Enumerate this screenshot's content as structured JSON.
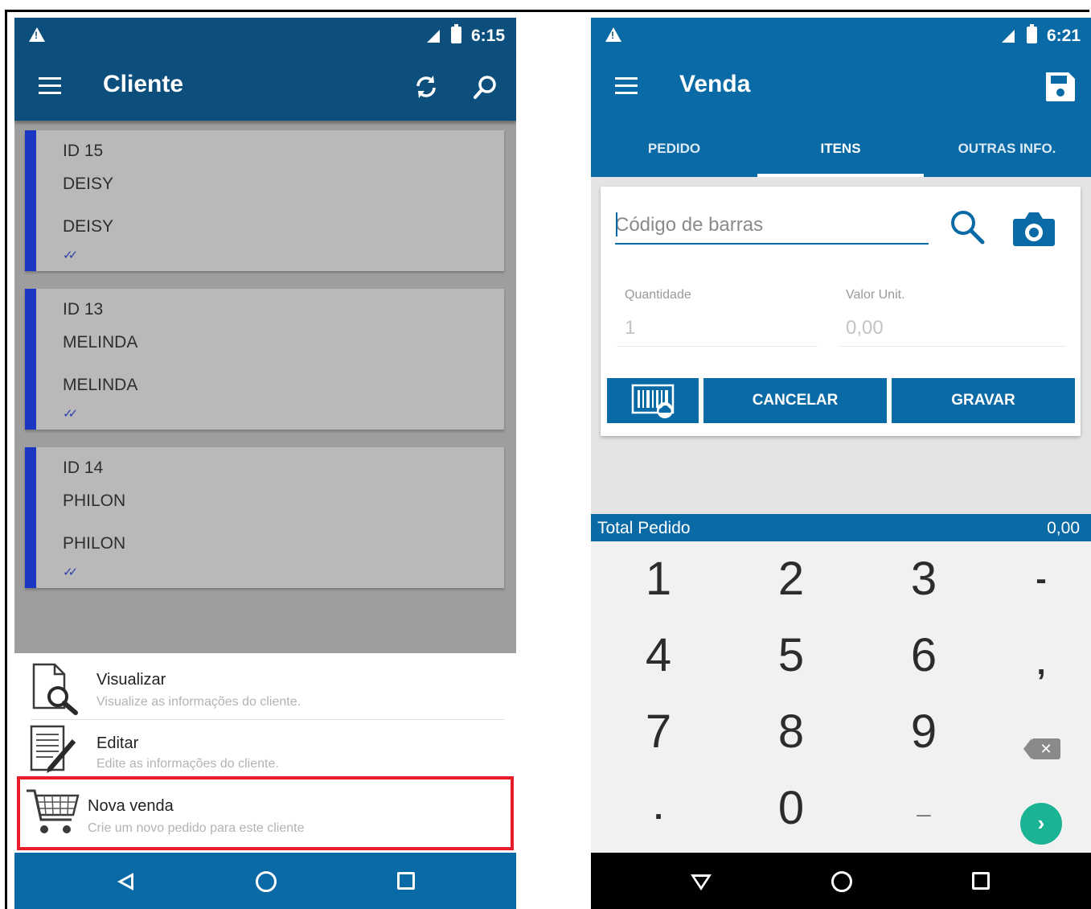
{
  "left_screen": {
    "status_bar": {
      "time": "6:15"
    },
    "appbar": {
      "title": "Cliente"
    },
    "clients": [
      {
        "id": "ID 15",
        "name": "DEISY",
        "fantasy": "DEISY"
      },
      {
        "id": "ID 13",
        "name": "MELINDA",
        "fantasy": "MELINDA"
      },
      {
        "id": "ID 14",
        "name": "PHILON",
        "fantasy": "PHILON"
      }
    ],
    "sheet": [
      {
        "title": "Visualizar",
        "subtitle": "Visualize as informações do cliente."
      },
      {
        "title": "Editar",
        "subtitle": "Edite as informações do cliente."
      },
      {
        "title": "Nova venda",
        "subtitle": "Crie um novo pedido para este cliente"
      }
    ],
    "colors": {
      "appbar": "#0d4f7c",
      "card_accent": "#1c36c4",
      "highlight": "#e81c28"
    }
  },
  "right_screen": {
    "status_bar": {
      "time": "6:21"
    },
    "appbar": {
      "title": "Venda"
    },
    "tabs": [
      {
        "label": "PEDIDO",
        "active": false
      },
      {
        "label": "ITENS",
        "active": true
      },
      {
        "label": "OUTRAS INFO.",
        "active": false
      }
    ],
    "form": {
      "barcode_placeholder": "Código de barras",
      "quantity_label": "Quantidade",
      "quantity_value": "1",
      "unit_value_label": "Valor Unit.",
      "unit_value_value": "0,00",
      "cancel_label": "CANCELAR",
      "save_label": "GRAVAR"
    },
    "total": {
      "label": "Total Pedido",
      "value": "0,00"
    },
    "keypad": {
      "keys": [
        "1",
        "2",
        "3",
        "-",
        "4",
        "5",
        "6",
        ",",
        "7",
        "8",
        "9",
        "0",
        ".",
        "_"
      ],
      "enter": "›",
      "backspace": "✕"
    },
    "colors": {
      "primary": "#0a6aa6",
      "enter_key": "#1ab394"
    }
  },
  "icons": [
    "menu-icon",
    "sync-icon",
    "search-icon",
    "save-icon",
    "camera-icon",
    "barcode-cloud-icon",
    "view-document-icon",
    "edit-document-icon",
    "cart-icon",
    "back-icon",
    "home-icon",
    "recent-apps-icon",
    "warning-icon",
    "signal-icon",
    "battery-icon",
    "double-check-icon"
  ]
}
